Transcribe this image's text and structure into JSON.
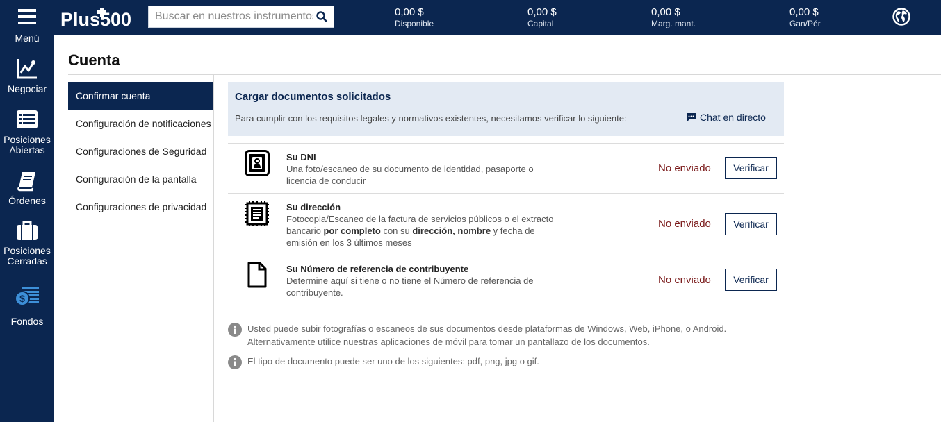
{
  "sidebar": {
    "menu": "Menú",
    "trade": "Negociar",
    "open_positions": [
      "Posiciones",
      "Abiertas"
    ],
    "orders": "Órdenes",
    "closed_positions": [
      "Posiciones",
      "Cerradas"
    ],
    "funds": "Fondos"
  },
  "header": {
    "brand": "Plus500",
    "search_placeholder": "Buscar en nuestros instrumentos",
    "stats": [
      {
        "value": "0,00 $",
        "label": "Disponible"
      },
      {
        "value": "0,00 $",
        "label": "Capital"
      },
      {
        "value": "0,00 $",
        "label": "Marg. mant."
      },
      {
        "value": "0,00 $",
        "label": "Gan/Pér"
      }
    ]
  },
  "page": {
    "title": "Cuenta"
  },
  "subnav": [
    "Confirmar cuenta",
    "Configuración de notificaciones",
    "Configuraciones de Seguridad",
    "Configuración de la pantalla",
    "Configuraciones de privacidad"
  ],
  "requirements": {
    "title": "Cargar documentos solicitados",
    "subtitle": "Para cumplir con los requisitos legales y normativos existentes, necesitamos verificar lo siguiente:",
    "chat": "Chat en directo"
  },
  "documents": [
    {
      "title": "Su DNI",
      "desc_lines": [
        "Una foto/escaneo de su documento de identidad, pasaporte o",
        "licencia de conducir"
      ],
      "status": "No enviado",
      "button": "Verificar"
    },
    {
      "title": "Su dirección",
      "desc_line1": "Fotocopia/Escaneo de la factura de servicios públicos o el extracto",
      "desc_parts": [
        "bancario ",
        "por completo",
        " con su ",
        "dirección, nombre",
        " y fecha de"
      ],
      "desc_line3": "emisión en los 3 últimos meses",
      "status": "No enviado",
      "button": "Verificar"
    },
    {
      "title": "Su Número de referencia de contribuyente",
      "desc_lines": [
        "Determine aquí si tiene o no tiene el Número de referencia de",
        "contribuyente."
      ],
      "status": "No enviado",
      "button": "Verificar"
    }
  ],
  "notes": [
    [
      "Usted puede subir fotografías o escaneos de sus documentos desde plataformas de Windows, Web, iPhone, o Android.",
      "Alternativamente utilice nuestras aplicaciones de móvil para tomar un pantallazo de los documentos."
    ],
    [
      "El tipo de documento puede ser uno de los siguientes: pdf, png, jpg o gif."
    ]
  ],
  "colors": {
    "navy": "#0b2650",
    "panel": "#e3eaf3",
    "status_red": "#7a1a1a",
    "funds_icon": "#3d8fd8"
  }
}
